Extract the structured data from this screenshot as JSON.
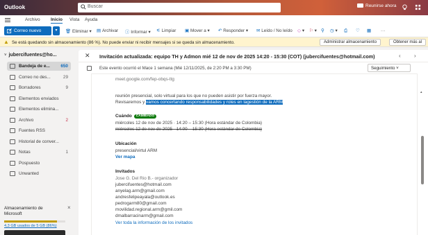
{
  "titlebar": {
    "app_name": "Outlook",
    "search_placeholder": "Buscar",
    "meet_now": "Reunirse ahora"
  },
  "menu": {
    "tabs": [
      "Archivo",
      "Inicio",
      "Vista",
      "Ayuda"
    ],
    "active_tab": "Inicio"
  },
  "ribbon": {
    "new_mail": "Correo nuevo",
    "delete": "Eliminar",
    "archive": "Archivar",
    "report": "Informar",
    "sweep": "Limpiar",
    "move_to": "Mover a",
    "reply": "Responder",
    "read_unread": "Leído / No leído",
    "more": "···"
  },
  "warning": {
    "message": "Se está quedando sin almacenamiento (86 %). No puede enviar ni recibir mensajes si se queda sin almacenamiento.",
    "manage_btn": "Administrar almacenamiento",
    "get_more_btn": "Obtener más al"
  },
  "folders": {
    "account": "jubercifuentes@ho...",
    "items": [
      {
        "label": "Bandeja de e...",
        "count": "650",
        "icon": "inbox-icon"
      },
      {
        "label": "Correo no des...",
        "count": "29",
        "icon": "junk-icon"
      },
      {
        "label": "Borradores",
        "count": "9",
        "icon": "drafts-icon"
      },
      {
        "label": "Elementos enviados",
        "count": "",
        "icon": "sent-icon"
      },
      {
        "label": "Elementos elimina...",
        "count": "",
        "icon": "deleted-icon"
      },
      {
        "label": "Archivo",
        "count": "2",
        "icon": "archive-icon"
      },
      {
        "label": "Fuentes RSS",
        "count": "",
        "icon": "folder-icon"
      },
      {
        "label": "Historial de conver...",
        "count": "",
        "icon": "folder-icon"
      },
      {
        "label": "Notas",
        "count": "1",
        "icon": "notes-icon"
      },
      {
        "label": "Pospuesto",
        "count": "",
        "icon": "snoozed-icon"
      },
      {
        "label": "Unwanted",
        "count": "",
        "icon": "folder-icon"
      }
    ]
  },
  "storage": {
    "title": "Almacenamiento de Microsoft",
    "usage": "4,3 GB usados de 5 GB (86%)",
    "fraction": 0.86
  },
  "message": {
    "subject": "Invitación actualizada: equipo TH y Admon mié 12 de nov de 2025 14:20 - 15:30 (COT) (jubercifuentes@hotmail.com)",
    "event_note": "Este evento ocurrió el Mace 1 semana (Mié 12/11/2025, de 2:20 PM a 3:30 PM)",
    "follow_up": "Seguimiento",
    "meet_link": "meet.google.com/fep-obqs-ttg",
    "body_line1": "reunión presencial, solo virtual para los que no pueden asistir por fuerza mayor.",
    "body_line2_prefix": "Revisaremos y ",
    "body_line2_highlight": "vamos concertando responsabilidades y roles en lagestión de la ARM",
    "when_label": "Cuándo",
    "changed_badge": "CAMBIADO",
    "when_new": "miércoles 12 de nov de 2025 · 14:20 – 15:30 (Hora estándar de Colombia)",
    "when_old": "miércoles 12 de nov de 2025 · 14:00 – 15:30 (Hora estándar de Colombia)",
    "location_label": "Ubicación",
    "location": "presencial/virtul ARM",
    "view_map": "Ver mapa",
    "guests_label": "Invitados",
    "guests": [
      "Jose G. Del Rio B.- organizador",
      "jubercifuentes@hotmail.com",
      "anyelag.arm@gmail.com",
      "andresfelipeayala@outlook.es",
      "pedrogarm80@gmail.com",
      "movilidad.regional.arm@gmil.com",
      "dmalbarracinarm@gmail.com"
    ],
    "see_all": "Ver toda la información de los invitados"
  }
}
